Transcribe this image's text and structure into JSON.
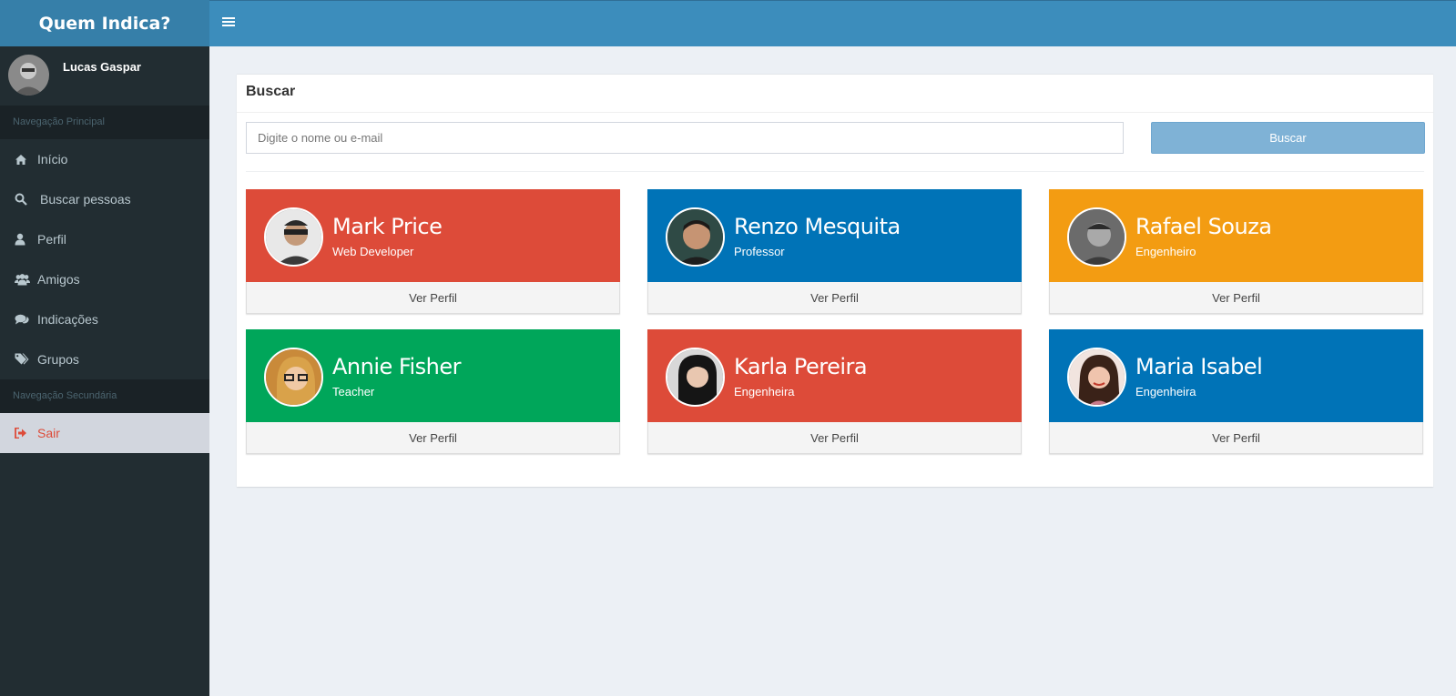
{
  "app": {
    "title": "Quem Indica?"
  },
  "sidebar": {
    "user_name": "Lucas Gaspar",
    "primary_header": "Navegação Principal",
    "secondary_header": "Navegação Secundária",
    "items": [
      {
        "label": "Início",
        "icon": "home-icon"
      },
      {
        "label": "Buscar pessoas",
        "icon": "search-icon"
      },
      {
        "label": "Perfil",
        "icon": "user-icon"
      },
      {
        "label": "Amigos",
        "icon": "users-icon"
      },
      {
        "label": "Indicações",
        "icon": "comments-icon"
      },
      {
        "label": "Grupos",
        "icon": "tags-icon"
      }
    ],
    "secondary_items": [
      {
        "label": "Sair",
        "icon": "sign-out-icon"
      }
    ]
  },
  "search": {
    "title": "Buscar",
    "placeholder": "Digite o nome ou e-mail",
    "button_label": "Buscar"
  },
  "profiles": [
    {
      "name": "Mark Price",
      "role": "Web Developer",
      "color": "#dd4b39",
      "action": "Ver Perfil"
    },
    {
      "name": "Renzo Mesquita",
      "role": "Professor",
      "color": "#0073b7",
      "action": "Ver Perfil"
    },
    {
      "name": "Rafael Souza",
      "role": "Engenheiro",
      "color": "#f39c12",
      "action": "Ver Perfil"
    },
    {
      "name": "Annie Fisher",
      "role": "Teacher",
      "color": "#00a65a",
      "action": "Ver Perfil"
    },
    {
      "name": "Karla Pereira",
      "role": "Engenheira",
      "color": "#dd4b39",
      "action": "Ver Perfil"
    },
    {
      "name": "Maria Isabel",
      "role": "Engenheira",
      "color": "#0073b7",
      "action": "Ver Perfil"
    }
  ],
  "colors": {
    "header": "#3c8dbc",
    "logo_bg": "#367fa9",
    "sidebar": "#222d32",
    "content_bg": "#ecf0f5",
    "danger": "#dd4b39"
  }
}
